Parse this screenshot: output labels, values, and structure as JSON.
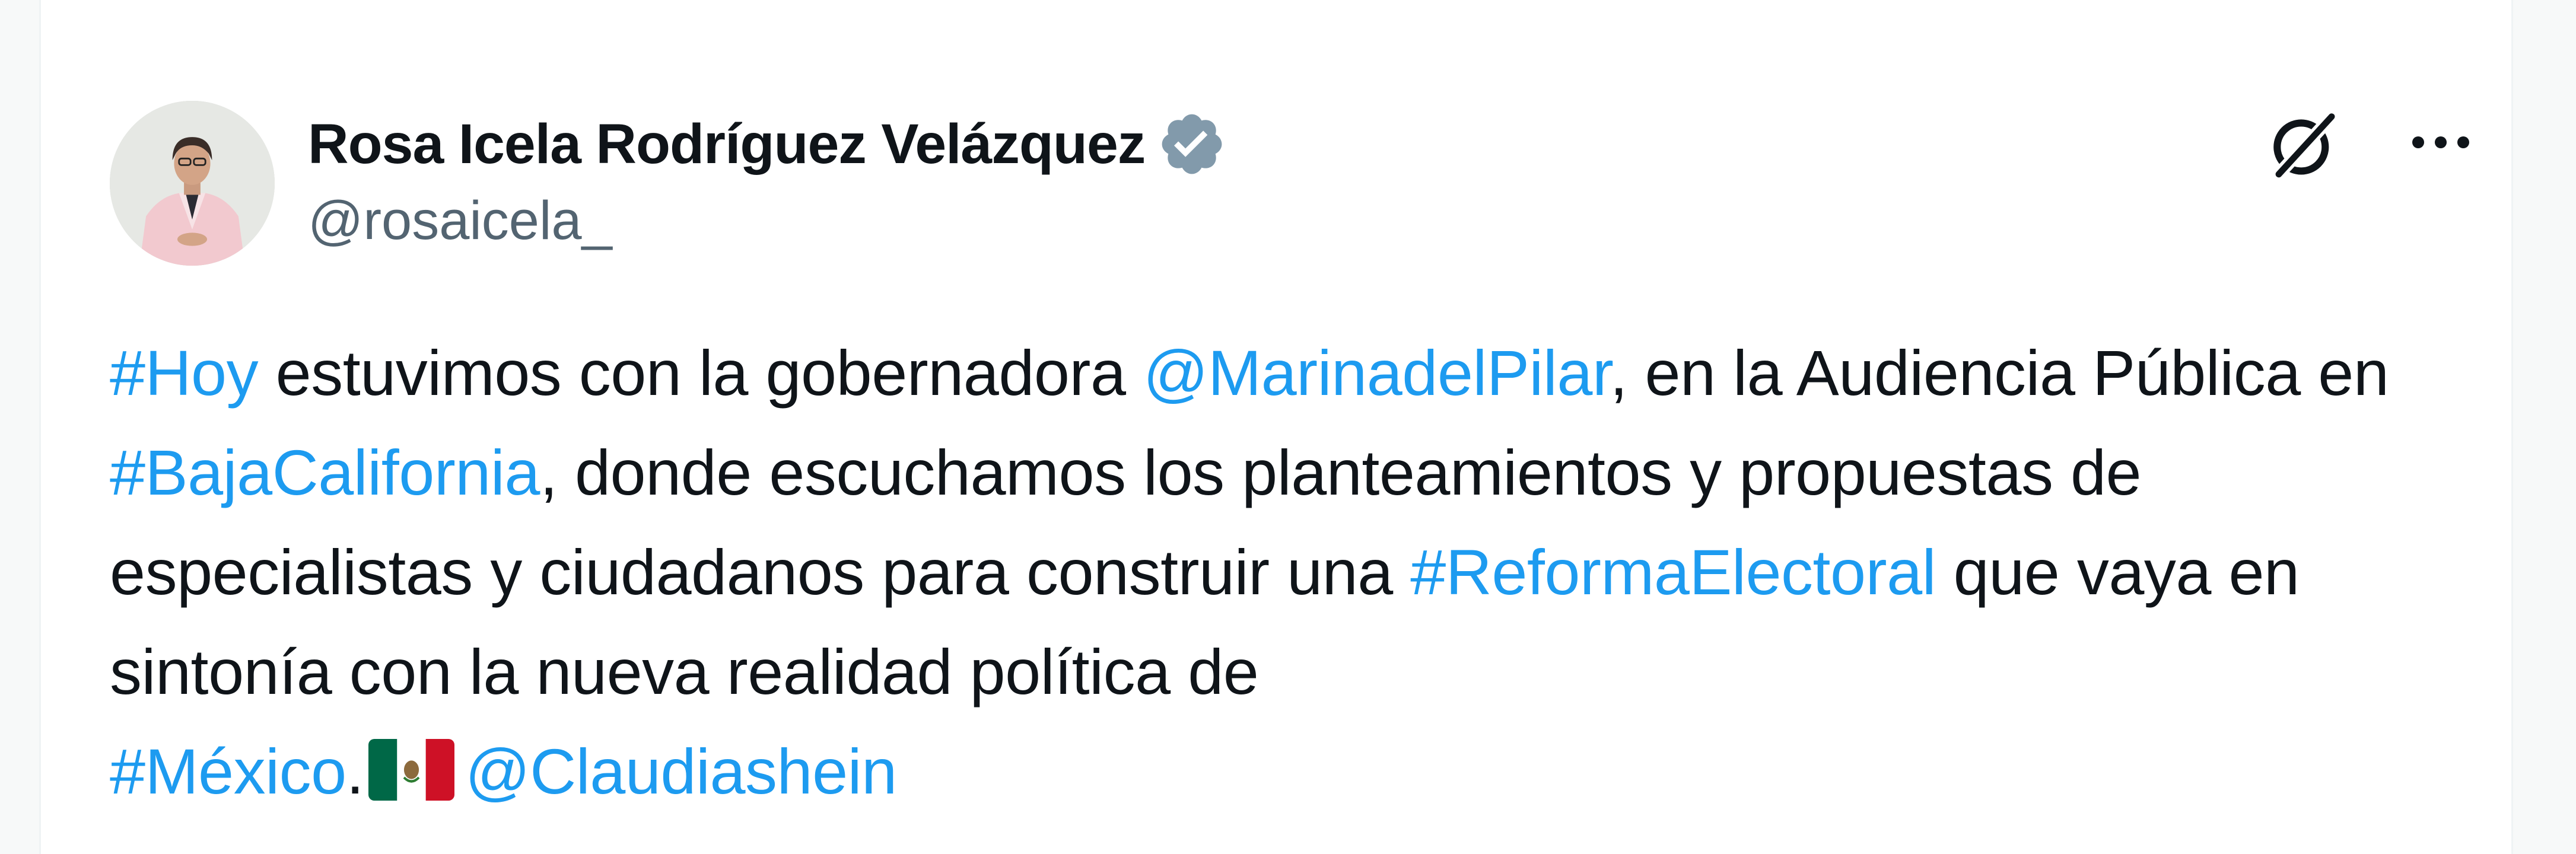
{
  "author": {
    "display_name": "Rosa Icela Rodríguez Velázquez",
    "handle": "@rosaicela_",
    "verified": true
  },
  "header_icons": [
    "grok-icon",
    "more-options-icon"
  ],
  "tweet": {
    "seg1": "#Hoy",
    "seg2": " estuvimos con la gobernadora ",
    "seg3": "@MarinadelPilar",
    "seg4": ", en la Audiencia Pública en ",
    "seg5": "#BajaCalifornia",
    "seg6": ", donde escuchamos los planteamientos y propuestas de especialistas y ciudadanos para construir una ",
    "seg7": "#ReformaElectoral",
    "seg8": " que vaya en sintonía con la nueva realidad política de ",
    "seg9": "#México",
    "seg10": ".",
    "seg11": "@Claudiashein",
    "emoji": "mexico-flag"
  },
  "colors": {
    "link": "#1d9bf0",
    "text": "#0f1419",
    "secondary_text": "#536471",
    "verified_badge": "#829aab"
  }
}
